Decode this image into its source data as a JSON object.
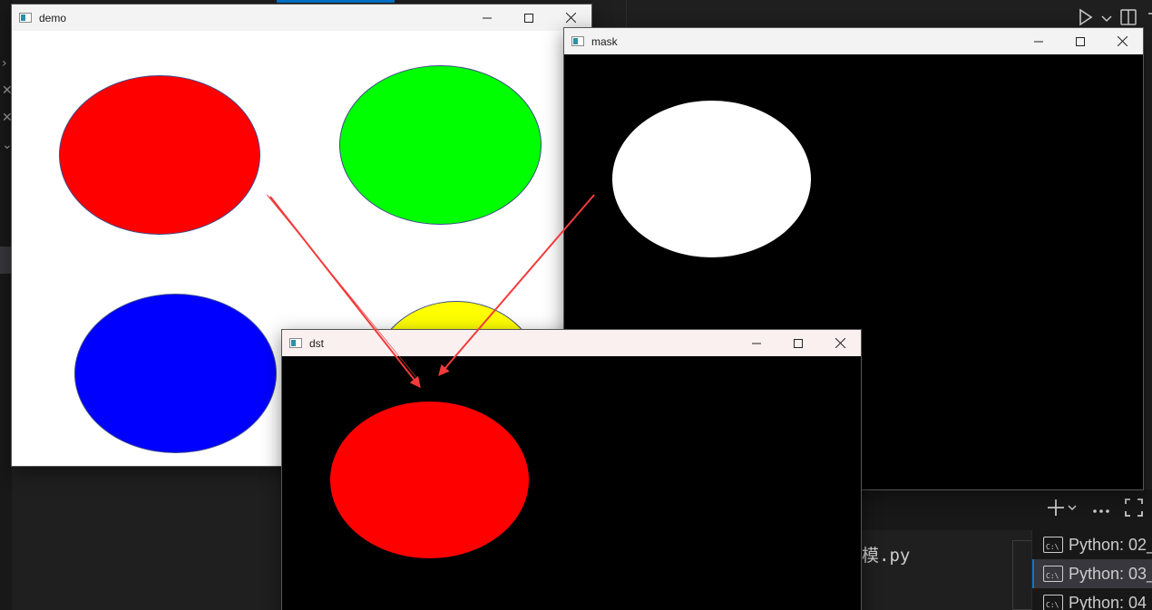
{
  "ide": {
    "editor_text": "模.py",
    "terminals": [
      {
        "label": "Python: 02_",
        "selected": false
      },
      {
        "label": "Python: 03_",
        "selected": true
      },
      {
        "label": "Python: 04",
        "selected": false
      }
    ],
    "terminal_icon_text": "C:\\"
  },
  "windows": {
    "demo": {
      "title": "demo",
      "background": "#ffffff"
    },
    "mask": {
      "title": "mask",
      "background": "#000000"
    },
    "dst": {
      "title": "dst",
      "background": "#000000"
    }
  },
  "shapes": {
    "demo": [
      {
        "name": "red-circle",
        "color": "#ff0000"
      },
      {
        "name": "green-circle",
        "color": "#00ff00"
      },
      {
        "name": "blue-circle",
        "color": "#0000ff"
      },
      {
        "name": "yellow-circle",
        "color": "#ffff00"
      }
    ],
    "mask": [
      {
        "name": "white-circle",
        "color": "#ffffff"
      }
    ],
    "dst": [
      {
        "name": "red-circle",
        "color": "#ff0000"
      }
    ]
  },
  "annotation": {
    "arrow_color": "#f23b3b"
  },
  "colors": {
    "ide_bg": "#1f1f1f",
    "accent": "#0078d4"
  }
}
